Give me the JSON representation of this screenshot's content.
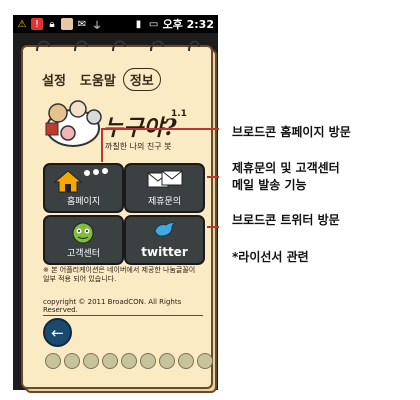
{
  "statusbar": {
    "time": "오후 2:32"
  },
  "tabs": [
    {
      "label": "설정"
    },
    {
      "label": "도움말"
    },
    {
      "label": "정보"
    }
  ],
  "logo": {
    "title": "누구야?",
    "version": "1.1",
    "subtitle": "까칠한 나의 친구 봇"
  },
  "buttons": {
    "homepage": {
      "label": "홈페이지"
    },
    "partnership": {
      "label": "제휴문의"
    },
    "support": {
      "label": "고객센터"
    },
    "twitter": {
      "label": "twitter"
    }
  },
  "notice": "※ 본 어플리케이션은 네이버에서 제공한 나눔글꼴이 일부 적용 되어 있습니다.",
  "copyright": "copyright © 2011 BroadCON. All Rights Reserved.",
  "callouts": {
    "c1": "브로드콘 홈페이지 방문",
    "c2_line1": "제휴문의 및 고객센터",
    "c2_line2": "메일 발송 기능",
    "c3": "브로드콘 트위터 방문",
    "c4": "*라이선서 관련"
  }
}
